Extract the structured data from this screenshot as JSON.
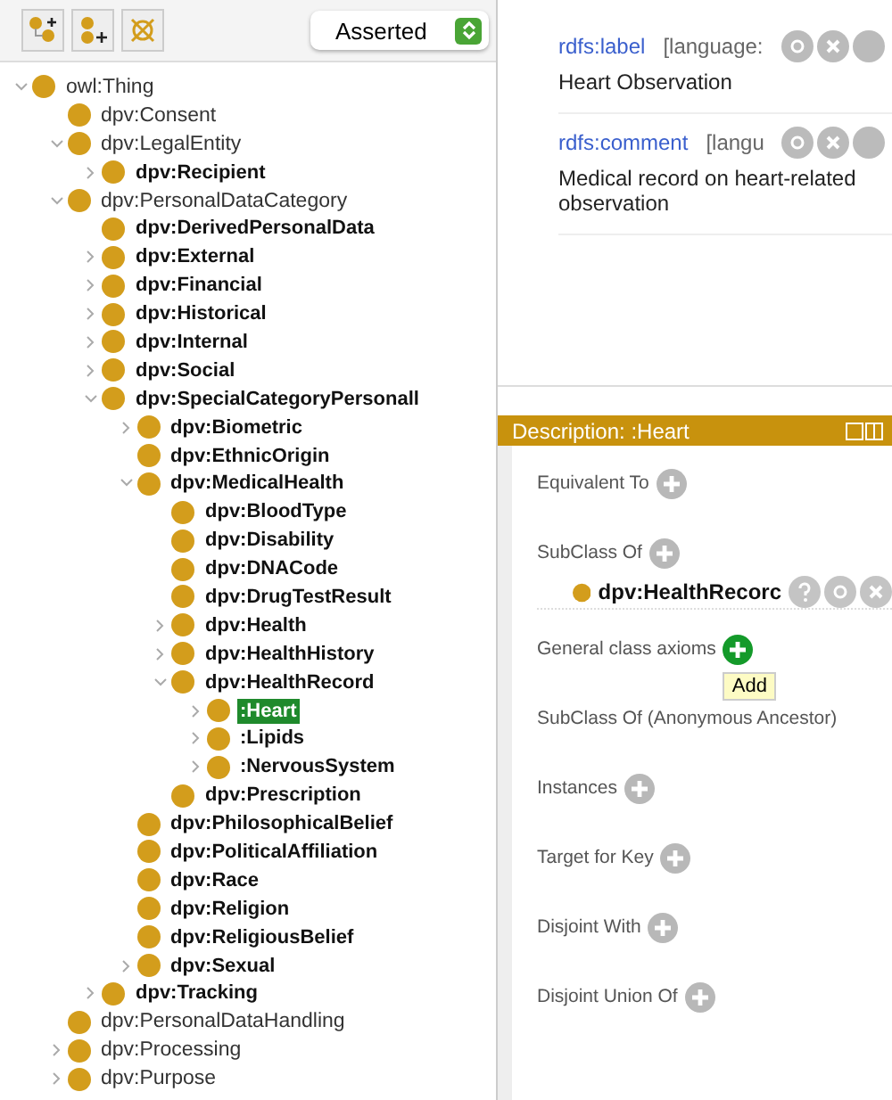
{
  "toolbar": {
    "buttons": [
      {
        "kind": "add-subclass"
      },
      {
        "kind": "add-sibling"
      },
      {
        "kind": "delete"
      }
    ],
    "view_selector": {
      "value": "Asserted"
    }
  },
  "class_tree": [
    {
      "label": "owl:Thing",
      "bold": false,
      "selected": false,
      "expanded": true,
      "children": [
        {
          "label": "dpv:Consent",
          "bold": false,
          "selected": false
        },
        {
          "label": "dpv:LegalEntity",
          "bold": false,
          "selected": false,
          "expanded": true,
          "children": [
            {
              "label": "dpv:Recipient",
              "bold": true,
              "selected": false,
              "expanded": false
            }
          ]
        },
        {
          "label": "dpv:PersonalDataCategory",
          "bold": false,
          "selected": false,
          "expanded": true,
          "children": [
            {
              "label": "dpv:DerivedPersonalData",
              "bold": true,
              "selected": false
            },
            {
              "label": "dpv:External",
              "bold": true,
              "selected": false,
              "expanded": false
            },
            {
              "label": "dpv:Financial",
              "bold": true,
              "selected": false,
              "expanded": false
            },
            {
              "label": "dpv:Historical",
              "bold": true,
              "selected": false,
              "expanded": false
            },
            {
              "label": "dpv:Internal",
              "bold": true,
              "selected": false,
              "expanded": false
            },
            {
              "label": "dpv:Social",
              "bold": true,
              "selected": false,
              "expanded": false
            },
            {
              "label": "dpv:SpecialCategoryPersonall",
              "bold": true,
              "selected": false,
              "expanded": true,
              "children": [
                {
                  "label": "dpv:Biometric",
                  "bold": true,
                  "selected": false,
                  "expanded": false
                },
                {
                  "label": "dpv:EthnicOrigin",
                  "bold": true,
                  "selected": false
                },
                {
                  "label": "dpv:MedicalHealth",
                  "bold": true,
                  "selected": false,
                  "expanded": true,
                  "children": [
                    {
                      "label": "dpv:BloodType",
                      "bold": true,
                      "selected": false
                    },
                    {
                      "label": "dpv:Disability",
                      "bold": true,
                      "selected": false
                    },
                    {
                      "label": "dpv:DNACode",
                      "bold": true,
                      "selected": false
                    },
                    {
                      "label": "dpv:DrugTestResult",
                      "bold": true,
                      "selected": false
                    },
                    {
                      "label": "dpv:Health",
                      "bold": true,
                      "selected": false,
                      "expanded": false
                    },
                    {
                      "label": "dpv:HealthHistory",
                      "bold": true,
                      "selected": false,
                      "expanded": false
                    },
                    {
                      "label": "dpv:HealthRecord",
                      "bold": true,
                      "selected": false,
                      "expanded": true,
                      "children": [
                        {
                          "label": ":Heart",
                          "bold": true,
                          "selected": true,
                          "expanded": false
                        },
                        {
                          "label": ":Lipids",
                          "bold": true,
                          "selected": false,
                          "expanded": false
                        },
                        {
                          "label": ":NervousSystem",
                          "bold": true,
                          "selected": false,
                          "expanded": false
                        }
                      ]
                    },
                    {
                      "label": "dpv:Prescription",
                      "bold": true,
                      "selected": false
                    }
                  ]
                },
                {
                  "label": "dpv:PhilosophicalBelief",
                  "bold": true,
                  "selected": false
                },
                {
                  "label": "dpv:PoliticalAffiliation",
                  "bold": true,
                  "selected": false
                },
                {
                  "label": "dpv:Race",
                  "bold": true,
                  "selected": false
                },
                {
                  "label": "dpv:Religion",
                  "bold": true,
                  "selected": false
                },
                {
                  "label": "dpv:ReligiousBelief",
                  "bold": true,
                  "selected": false
                },
                {
                  "label": "dpv:Sexual",
                  "bold": true,
                  "selected": false,
                  "expanded": false
                }
              ]
            },
            {
              "label": "dpv:Tracking",
              "bold": true,
              "selected": false,
              "expanded": false
            }
          ]
        },
        {
          "label": "dpv:PersonalDataHandling",
          "bold": false,
          "selected": false
        },
        {
          "label": "dpv:Processing",
          "bold": false,
          "selected": false,
          "expanded": false
        },
        {
          "label": "dpv:Purpose",
          "bold": false,
          "selected": false,
          "expanded": false
        }
      ]
    }
  ],
  "annotations": [
    {
      "property": "rdfs:label",
      "language": "[language:",
      "value": "Heart Observation"
    },
    {
      "property": "rdfs:comment",
      "language": "[langu",
      "value": "Medical record on heart-related observation"
    }
  ],
  "description": {
    "title": "Description: :Heart",
    "sections": [
      {
        "label": "Equivalent To",
        "highlighted": false
      },
      {
        "label": "SubClass Of",
        "highlighted": false,
        "items": [
          {
            "label": "dpv:HealthRecorc"
          }
        ]
      },
      {
        "label": "General class axioms",
        "highlighted": true,
        "tooltip": "Add"
      },
      {
        "label": "SubClass Of (Anonymous Ancestor)"
      },
      {
        "label": "Instances",
        "highlighted": false
      },
      {
        "label": "Target for Key",
        "highlighted": false
      },
      {
        "label": "Disjoint With",
        "highlighted": false
      },
      {
        "label": "Disjoint Union Of",
        "highlighted": false
      }
    ]
  }
}
